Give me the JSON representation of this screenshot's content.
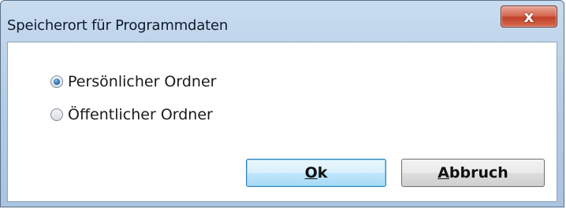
{
  "window": {
    "title": "Speicherort für Programmdaten",
    "close_glyph": "x"
  },
  "options": [
    {
      "label": "Persönlicher Ordner",
      "selected": true
    },
    {
      "label": "Öffentlicher Ordner",
      "selected": false
    }
  ],
  "buttons": {
    "ok": {
      "mnemonic": "O",
      "rest": "k"
    },
    "cancel": {
      "mnemonic": "A",
      "rest": "bbruch"
    }
  },
  "colors": {
    "title_gradient_top": "#c9dcef",
    "close_red": "#c2422a",
    "radio_selected": "#2a6fb8",
    "default_button_border": "#3c7fb1"
  }
}
